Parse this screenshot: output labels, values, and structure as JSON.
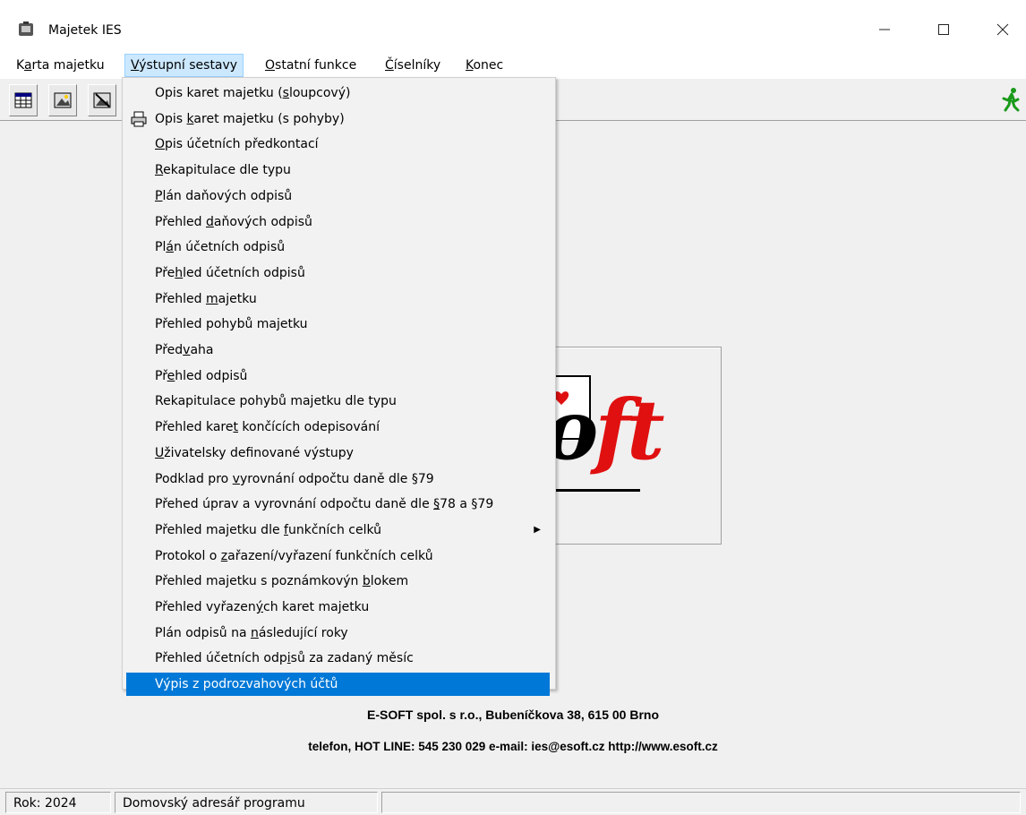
{
  "window": {
    "title": "Majetek IES"
  },
  "menubar": {
    "items": [
      {
        "pre": "K",
        "u": "a",
        "post": "rta majetku"
      },
      {
        "pre": "",
        "u": "V",
        "post": "ýstupní sestavy"
      },
      {
        "pre": "",
        "u": "O",
        "post": "statní funkce"
      },
      {
        "pre": "",
        "u": "Č",
        "post": "íselníky"
      },
      {
        "pre": "",
        "u": "K",
        "post": "onec"
      }
    ]
  },
  "dropdown": {
    "items": [
      {
        "pre": "Opis karet majetku (",
        "u": "s",
        "post": "loupcový)"
      },
      {
        "pre": "Opis ",
        "u": "k",
        "post": "aret majetku (s pohyby)"
      },
      {
        "pre": "",
        "u": "O",
        "post": "pis účetních předkontací"
      },
      {
        "pre": "",
        "u": "R",
        "post": "ekapitulace dle typu"
      },
      {
        "pre": "",
        "u": "P",
        "post": "lán daňových odpisů"
      },
      {
        "pre": "Přehled ",
        "u": "d",
        "post": "aňových odpisů"
      },
      {
        "pre": "Pl",
        "u": "á",
        "post": "n účetních odpisů"
      },
      {
        "pre": "Pře",
        "u": "h",
        "post": "led účetních odpisů"
      },
      {
        "pre": "Přehled ",
        "u": "m",
        "post": "ajetku"
      },
      {
        "pre": "Přehled pohybů majetku",
        "u": "",
        "post": ""
      },
      {
        "pre": "Před",
        "u": "v",
        "post": "aha"
      },
      {
        "pre": "Př",
        "u": "e",
        "post": "hled odpisů"
      },
      {
        "pre": "Rekapitulace pohybů majetku dle typu",
        "u": "",
        "post": ""
      },
      {
        "pre": "Přehled kare",
        "u": "t",
        "post": " končících odepisování"
      },
      {
        "pre": "",
        "u": "U",
        "post": "živatelsky definované výstupy"
      },
      {
        "pre": "Podklad pro ",
        "u": "v",
        "post": "yrovnání odpočtu daně dle §79"
      },
      {
        "pre": "Přehed úprav a vyrovnání odpočtu daně dle ",
        "u": "§",
        "post": "78 a §79"
      },
      {
        "pre": "Přehled majetku dle ",
        "u": "f",
        "post": "unkčních celků"
      },
      {
        "pre": "Protokol o ",
        "u": "z",
        "post": "ařazení/vyřazení funkčních celků"
      },
      {
        "pre": "Přehled majetku s poznámkovýn ",
        "u": "b",
        "post": "lokem"
      },
      {
        "pre": "Přehled vyřazen",
        "u": "ý",
        "post": "ch karet majetku"
      },
      {
        "pre": "Plán odpisů na ",
        "u": "n",
        "post": "ásledující roky"
      },
      {
        "pre": "Přehled účetních odp",
        "u": "i",
        "post": "sů za zadaný měsíc"
      },
      {
        "pre": "Výpis z podrozvahových účtů",
        "u": "",
        "post": ""
      }
    ]
  },
  "company": {
    "line1": "E-SOFT spol. s r.o.,  Bubeníčkova 38, 615 00 Brno",
    "line2": "telefon, HOT LINE: 545 230 029  e-mail: ies@esoft.cz  http://www.esoft.cz"
  },
  "status": {
    "year": "Rok: 2024",
    "dir": "Domovský adresář programu"
  },
  "colors": {
    "selection": "#0078d7",
    "logo_red": "#e01010"
  }
}
